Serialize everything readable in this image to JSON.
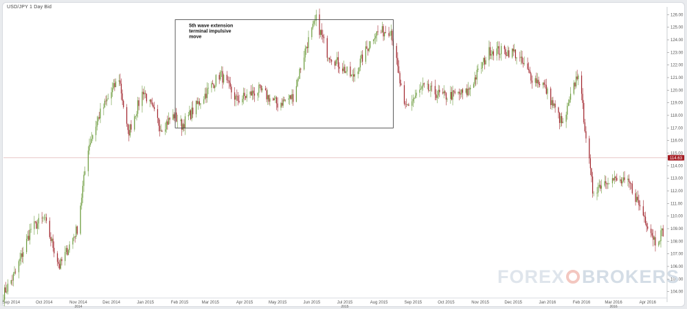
{
  "header": {
    "symbol": "USD/JPY  1 Day Bid"
  },
  "annotation": {
    "lines": [
      "5th wave extension",
      "terminal impulsive",
      "move"
    ]
  },
  "watermark": {
    "part1": "FOREX",
    "part2": "BROKERS"
  },
  "colors": {
    "up": "#6a9a3a",
    "down": "#a0222a",
    "price_label_bg": "#a51d24",
    "box": "#333333"
  },
  "chart_data": {
    "type": "candlestick",
    "title": "USD/JPY  1 Day Bid",
    "ylim": [
      103.6,
      126.4
    ],
    "y_ticks": [
      "126.00",
      "125.00",
      "124.00",
      "123.00",
      "122.00",
      "121.00",
      "120.00",
      "119.00",
      "118.00",
      "117.00",
      "116.00",
      "115.00",
      "114.00",
      "113.00",
      "112.00",
      "111.00",
      "110.00",
      "109.00",
      "108.00",
      "107.00",
      "106.00",
      "105.00",
      "104.00"
    ],
    "last_price": 114.63,
    "last_price_label": "114.63",
    "x_ticks": [
      "Sep 2014",
      "Oct 2014",
      "Nov 2014",
      "Dec 2014",
      "Jan 2015",
      "Feb 2015",
      "Mar 2015",
      "Apr 2015",
      "May 2015",
      "Jun 2015",
      "Jul 2015",
      "Aug 2015",
      "Sep 2015",
      "Oct 2015",
      "Nov 2015",
      "Dec 2015",
      "Jan 2016",
      "Feb 2016",
      "Mar 2016",
      "Apr 2016"
    ],
    "x_sublabels": [
      "2014",
      "2015",
      "2016"
    ],
    "highlight_box": {
      "from": "2015-01-28",
      "to": "2015-08-14",
      "y_range": [
        117.0,
        125.6
      ]
    },
    "series": [
      {
        "name": "USD/JPY",
        "keypoints": [
          [
            "2014-08-25",
            103.8
          ],
          [
            "2014-09-05",
            105.5
          ],
          [
            "2014-09-19",
            109.0
          ],
          [
            "2014-10-01",
            109.8
          ],
          [
            "2014-10-15",
            106.0
          ],
          [
            "2014-10-31",
            109.0
          ],
          [
            "2014-11-10",
            115.5
          ],
          [
            "2014-11-20",
            118.0
          ],
          [
            "2014-12-08",
            121.0
          ],
          [
            "2014-12-16",
            116.5
          ],
          [
            "2014-12-30",
            120.0
          ],
          [
            "2015-01-15",
            117.0
          ],
          [
            "2015-01-27",
            118.0
          ],
          [
            "2015-02-03",
            117.2
          ],
          [
            "2015-03-10",
            121.3
          ],
          [
            "2015-03-25",
            119.2
          ],
          [
            "2015-04-14",
            120.0
          ],
          [
            "2015-05-01",
            118.9
          ],
          [
            "2015-05-15",
            119.5
          ],
          [
            "2015-05-27",
            123.5
          ],
          [
            "2015-06-05",
            125.6
          ],
          [
            "2015-06-15",
            123.0
          ],
          [
            "2015-07-08",
            121.0
          ],
          [
            "2015-07-28",
            124.5
          ],
          [
            "2015-08-12",
            124.8
          ],
          [
            "2015-08-24",
            118.5
          ],
          [
            "2015-09-10",
            120.2
          ],
          [
            "2015-09-29",
            119.5
          ],
          [
            "2015-10-20",
            119.8
          ],
          [
            "2015-11-10",
            123.2
          ],
          [
            "2015-12-02",
            123.0
          ],
          [
            "2015-12-18",
            121.0
          ],
          [
            "2015-12-28",
            120.5
          ],
          [
            "2016-01-15",
            117.2
          ],
          [
            "2016-01-29",
            121.5
          ],
          [
            "2016-02-11",
            112.0
          ],
          [
            "2016-02-25",
            113.0
          ],
          [
            "2016-03-16",
            112.5
          ],
          [
            "2016-04-08",
            108.0
          ],
          [
            "2016-04-15",
            108.8
          ]
        ]
      }
    ]
  }
}
